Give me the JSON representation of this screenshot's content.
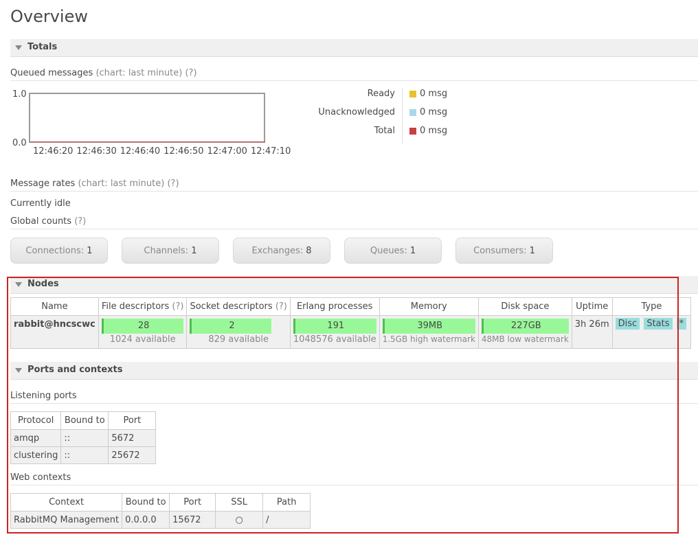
{
  "page": {
    "title": "Overview"
  },
  "totals": {
    "section_label": "Totals",
    "queued": {
      "label": "Queued messages",
      "chart_hint": "(chart: last minute)",
      "help": "(?)"
    },
    "chart_data": {
      "type": "line",
      "x": [
        "12:46:20",
        "12:46:30",
        "12:46:40",
        "12:46:50",
        "12:47:00",
        "12:47:10"
      ],
      "series": [
        {
          "name": "Ready",
          "values": [
            0,
            0,
            0,
            0,
            0,
            0
          ],
          "color": "#e8c030"
        },
        {
          "name": "Unacknowledged",
          "values": [
            0,
            0,
            0,
            0,
            0,
            0
          ],
          "color": "#a8d8f0"
        },
        {
          "name": "Total",
          "values": [
            0,
            0,
            0,
            0,
            0,
            0
          ],
          "color": "#c84040"
        }
      ],
      "ylim": [
        0.0,
        1.0
      ],
      "y_ticks": [
        "1.0",
        "0.0"
      ],
      "legend": "right"
    },
    "legend": [
      {
        "label": "Ready",
        "value": "0 msg",
        "color": "#e8c030"
      },
      {
        "label": "Unacknowledged",
        "value": "0 msg",
        "color": "#a8d8f0"
      },
      {
        "label": "Total",
        "value": "0 msg",
        "color": "#c84040"
      }
    ],
    "rates": {
      "label": "Message rates",
      "chart_hint": "(chart: last minute)",
      "help": "(?)",
      "status": "Currently idle"
    },
    "global_counts": {
      "label": "Global counts",
      "help": "(?)",
      "buttons": [
        {
          "label": "Connections:",
          "value": "1"
        },
        {
          "label": "Channels:",
          "value": "1"
        },
        {
          "label": "Exchanges:",
          "value": "8"
        },
        {
          "label": "Queues:",
          "value": "1"
        },
        {
          "label": "Consumers:",
          "value": "1"
        }
      ]
    }
  },
  "nodes": {
    "section_label": "Nodes",
    "columns": {
      "name": "Name",
      "fd": "File descriptors",
      "fd_help": "(?)",
      "sd": "Socket descriptors",
      "sd_help": "(?)",
      "erlang": "Erlang processes",
      "memory": "Memory",
      "disk": "Disk space",
      "uptime": "Uptime",
      "type": "Type"
    },
    "row": {
      "name": "rabbit@hncscwc",
      "fd_used": "28",
      "fd_available": "1024 available",
      "sd_used": "2",
      "sd_available": "829 available",
      "erlang_used": "191",
      "erlang_available": "1048576 available",
      "memory_used": "39MB",
      "memory_watermark": "1.5GB high watermark",
      "disk_free": "227GB",
      "disk_watermark": "48MB low watermark",
      "uptime": "3h 26m",
      "type_tags": [
        "Disc",
        "Stats",
        "*"
      ]
    }
  },
  "ports": {
    "section_label": "Ports and contexts",
    "listening": {
      "label": "Listening ports",
      "headers": [
        "Protocol",
        "Bound to",
        "Port"
      ],
      "rows": [
        [
          "amqp",
          "::",
          "5672"
        ],
        [
          "clustering",
          "::",
          "25672"
        ]
      ]
    },
    "web": {
      "label": "Web contexts",
      "headers": [
        "Context",
        "Bound to",
        "Port",
        "SSL",
        "Path"
      ],
      "rows": [
        [
          "RabbitMQ Management",
          "0.0.0.0",
          "15672",
          "○",
          "/"
        ]
      ]
    }
  }
}
